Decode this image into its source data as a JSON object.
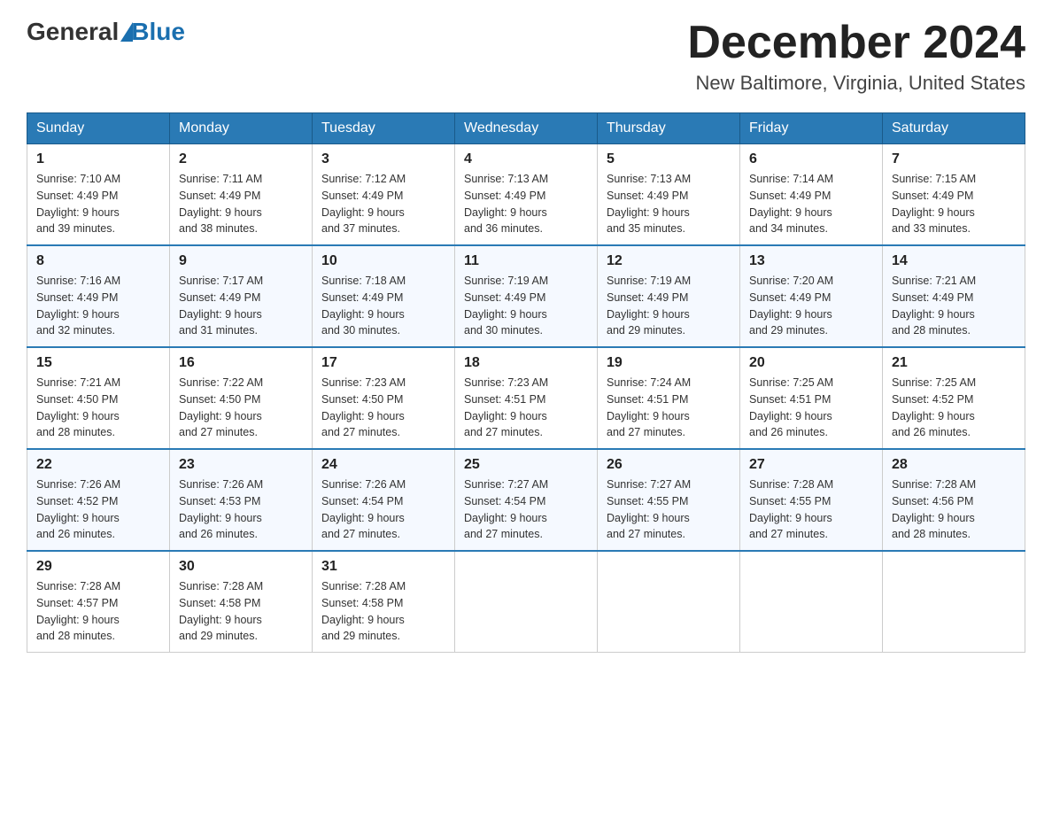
{
  "header": {
    "logo_general": "General",
    "logo_blue": "Blue",
    "month": "December 2024",
    "location": "New Baltimore, Virginia, United States"
  },
  "days_of_week": [
    "Sunday",
    "Monday",
    "Tuesday",
    "Wednesday",
    "Thursday",
    "Friday",
    "Saturday"
  ],
  "weeks": [
    [
      {
        "day": "1",
        "sunrise": "7:10 AM",
        "sunset": "4:49 PM",
        "daylight": "9 hours and 39 minutes."
      },
      {
        "day": "2",
        "sunrise": "7:11 AM",
        "sunset": "4:49 PM",
        "daylight": "9 hours and 38 minutes."
      },
      {
        "day": "3",
        "sunrise": "7:12 AM",
        "sunset": "4:49 PM",
        "daylight": "9 hours and 37 minutes."
      },
      {
        "day": "4",
        "sunrise": "7:13 AM",
        "sunset": "4:49 PM",
        "daylight": "9 hours and 36 minutes."
      },
      {
        "day": "5",
        "sunrise": "7:13 AM",
        "sunset": "4:49 PM",
        "daylight": "9 hours and 35 minutes."
      },
      {
        "day": "6",
        "sunrise": "7:14 AM",
        "sunset": "4:49 PM",
        "daylight": "9 hours and 34 minutes."
      },
      {
        "day": "7",
        "sunrise": "7:15 AM",
        "sunset": "4:49 PM",
        "daylight": "9 hours and 33 minutes."
      }
    ],
    [
      {
        "day": "8",
        "sunrise": "7:16 AM",
        "sunset": "4:49 PM",
        "daylight": "9 hours and 32 minutes."
      },
      {
        "day": "9",
        "sunrise": "7:17 AM",
        "sunset": "4:49 PM",
        "daylight": "9 hours and 31 minutes."
      },
      {
        "day": "10",
        "sunrise": "7:18 AM",
        "sunset": "4:49 PM",
        "daylight": "9 hours and 30 minutes."
      },
      {
        "day": "11",
        "sunrise": "7:19 AM",
        "sunset": "4:49 PM",
        "daylight": "9 hours and 30 minutes."
      },
      {
        "day": "12",
        "sunrise": "7:19 AM",
        "sunset": "4:49 PM",
        "daylight": "9 hours and 29 minutes."
      },
      {
        "day": "13",
        "sunrise": "7:20 AM",
        "sunset": "4:49 PM",
        "daylight": "9 hours and 29 minutes."
      },
      {
        "day": "14",
        "sunrise": "7:21 AM",
        "sunset": "4:49 PM",
        "daylight": "9 hours and 28 minutes."
      }
    ],
    [
      {
        "day": "15",
        "sunrise": "7:21 AM",
        "sunset": "4:50 PM",
        "daylight": "9 hours and 28 minutes."
      },
      {
        "day": "16",
        "sunrise": "7:22 AM",
        "sunset": "4:50 PM",
        "daylight": "9 hours and 27 minutes."
      },
      {
        "day": "17",
        "sunrise": "7:23 AM",
        "sunset": "4:50 PM",
        "daylight": "9 hours and 27 minutes."
      },
      {
        "day": "18",
        "sunrise": "7:23 AM",
        "sunset": "4:51 PM",
        "daylight": "9 hours and 27 minutes."
      },
      {
        "day": "19",
        "sunrise": "7:24 AM",
        "sunset": "4:51 PM",
        "daylight": "9 hours and 27 minutes."
      },
      {
        "day": "20",
        "sunrise": "7:25 AM",
        "sunset": "4:51 PM",
        "daylight": "9 hours and 26 minutes."
      },
      {
        "day": "21",
        "sunrise": "7:25 AM",
        "sunset": "4:52 PM",
        "daylight": "9 hours and 26 minutes."
      }
    ],
    [
      {
        "day": "22",
        "sunrise": "7:26 AM",
        "sunset": "4:52 PM",
        "daylight": "9 hours and 26 minutes."
      },
      {
        "day": "23",
        "sunrise": "7:26 AM",
        "sunset": "4:53 PM",
        "daylight": "9 hours and 26 minutes."
      },
      {
        "day": "24",
        "sunrise": "7:26 AM",
        "sunset": "4:54 PM",
        "daylight": "9 hours and 27 minutes."
      },
      {
        "day": "25",
        "sunrise": "7:27 AM",
        "sunset": "4:54 PM",
        "daylight": "9 hours and 27 minutes."
      },
      {
        "day": "26",
        "sunrise": "7:27 AM",
        "sunset": "4:55 PM",
        "daylight": "9 hours and 27 minutes."
      },
      {
        "day": "27",
        "sunrise": "7:28 AM",
        "sunset": "4:55 PM",
        "daylight": "9 hours and 27 minutes."
      },
      {
        "day": "28",
        "sunrise": "7:28 AM",
        "sunset": "4:56 PM",
        "daylight": "9 hours and 28 minutes."
      }
    ],
    [
      {
        "day": "29",
        "sunrise": "7:28 AM",
        "sunset": "4:57 PM",
        "daylight": "9 hours and 28 minutes."
      },
      {
        "day": "30",
        "sunrise": "7:28 AM",
        "sunset": "4:58 PM",
        "daylight": "9 hours and 29 minutes."
      },
      {
        "day": "31",
        "sunrise": "7:28 AM",
        "sunset": "4:58 PM",
        "daylight": "9 hours and 29 minutes."
      },
      null,
      null,
      null,
      null
    ]
  ],
  "labels": {
    "sunrise": "Sunrise:",
    "sunset": "Sunset:",
    "daylight": "Daylight:"
  }
}
